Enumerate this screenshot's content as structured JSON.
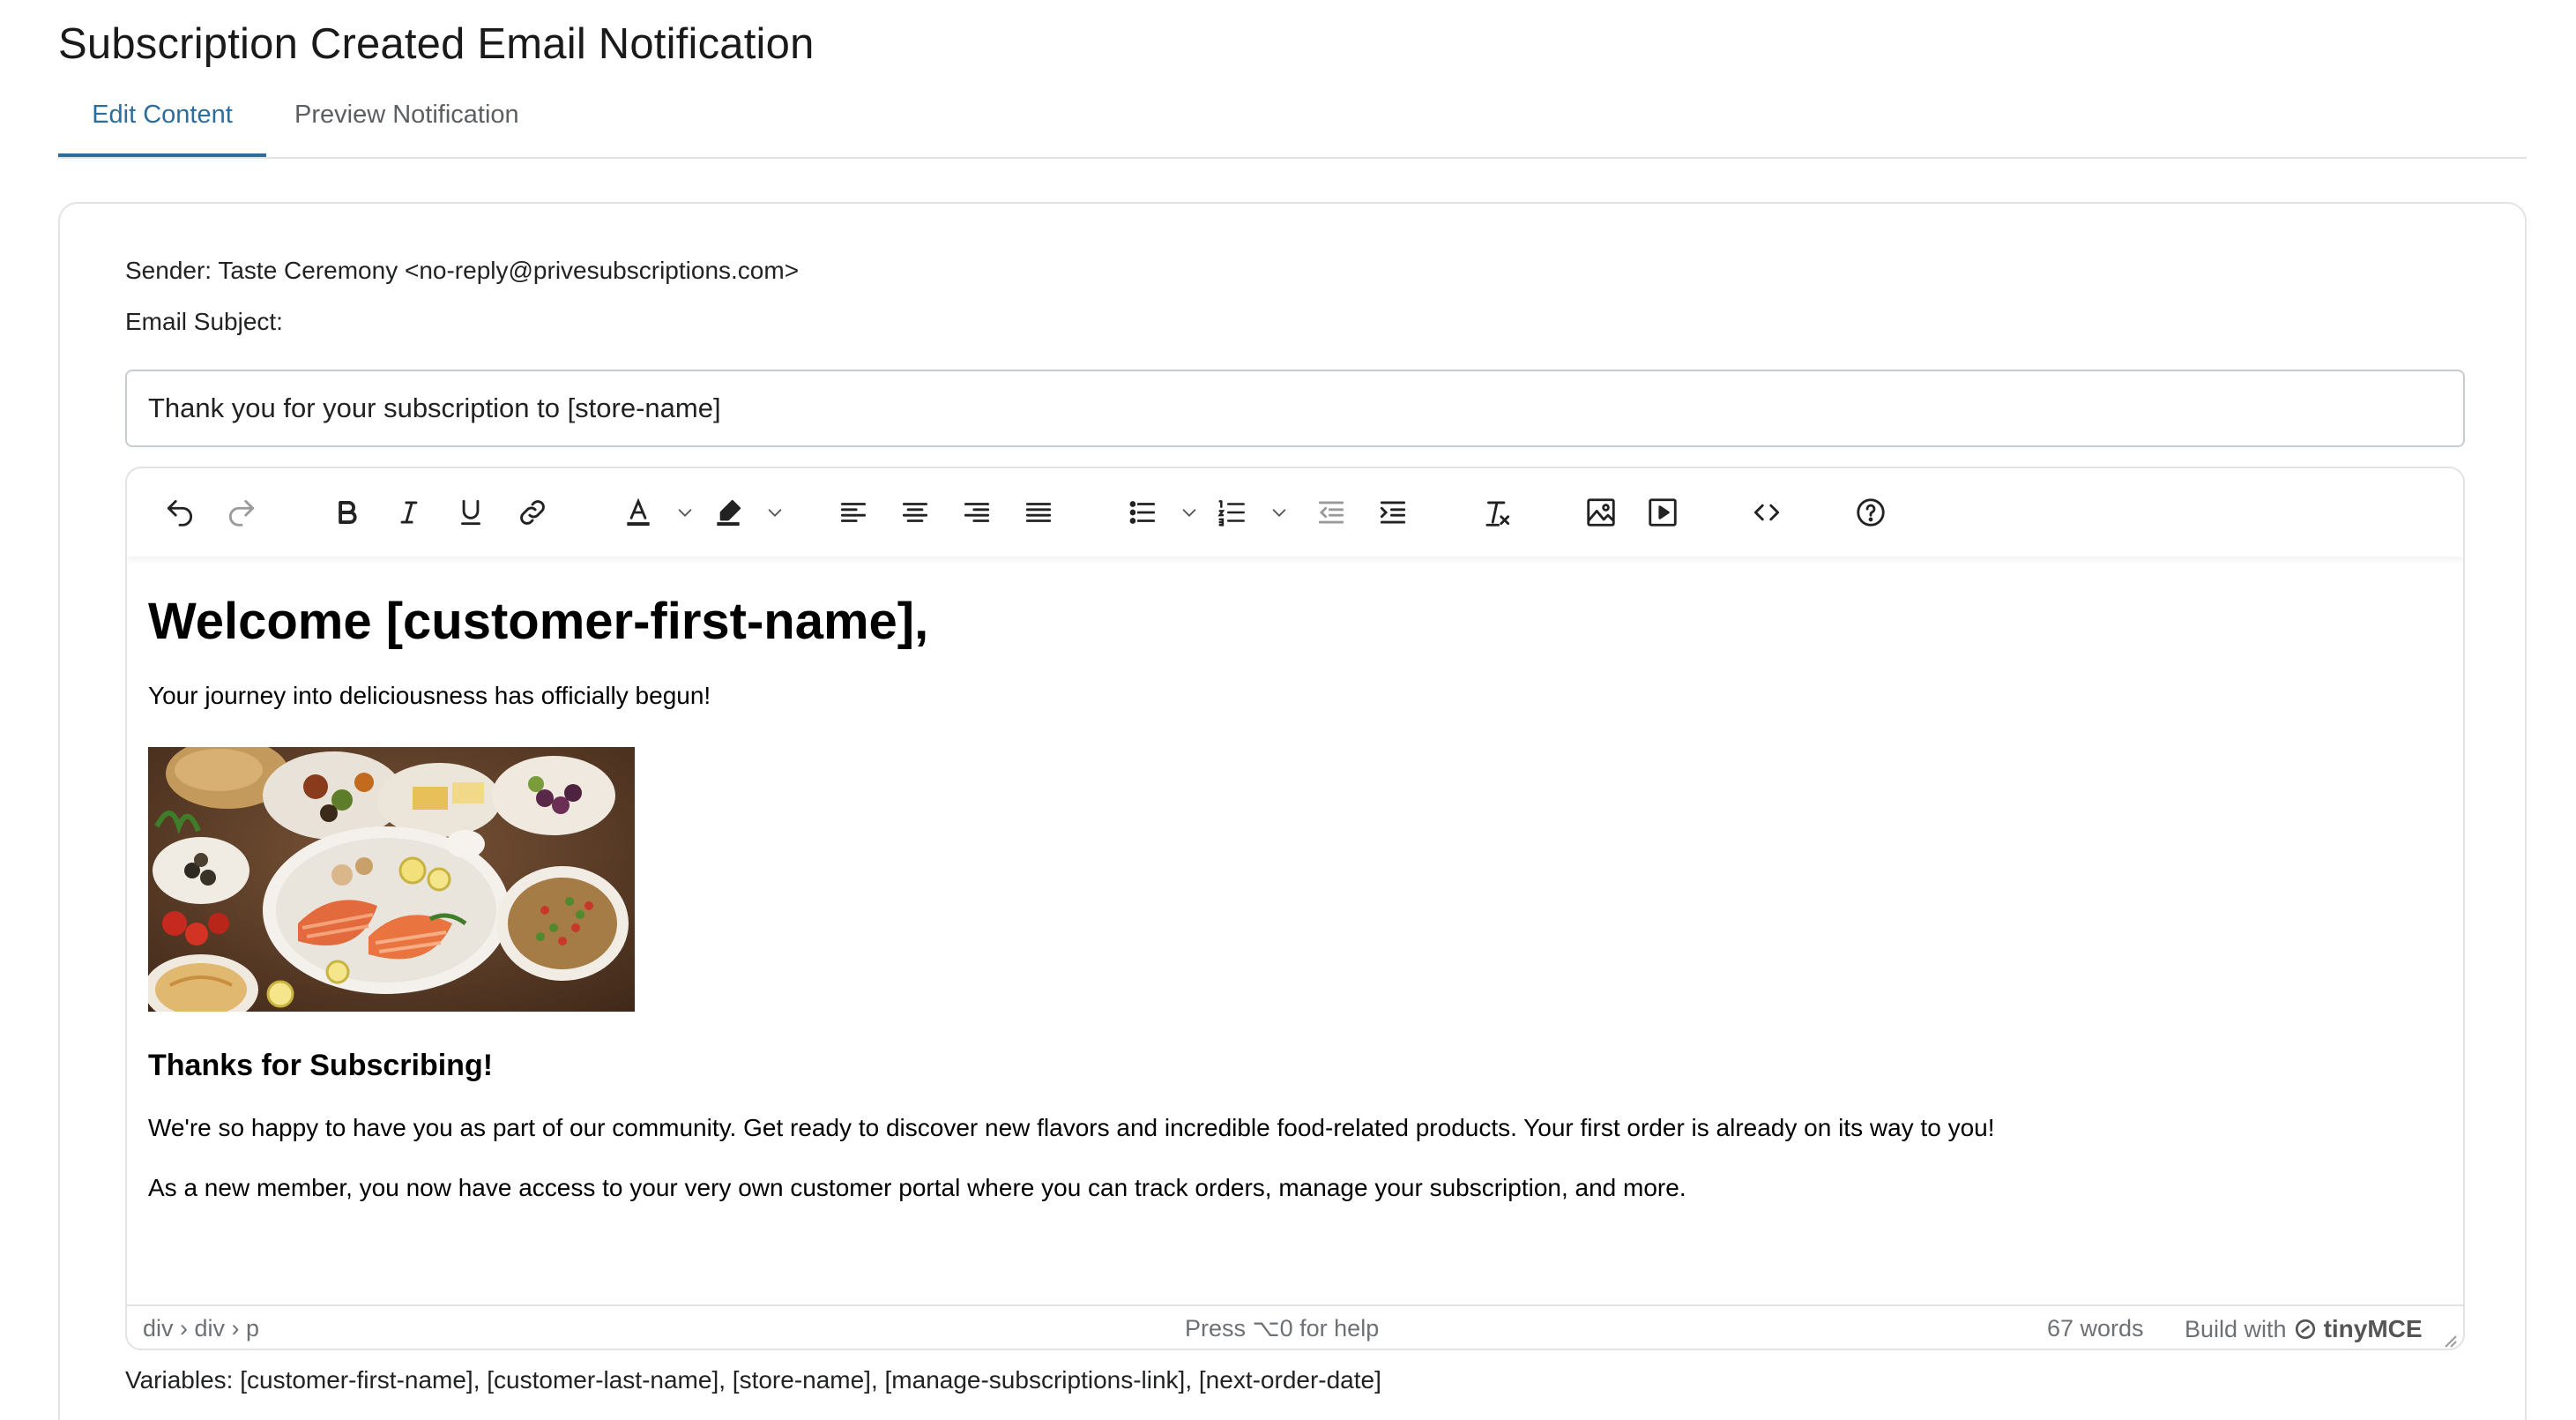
{
  "page": {
    "title": "Subscription Created Email Notification"
  },
  "tabs": [
    {
      "label": "Edit Content",
      "active": true
    },
    {
      "label": "Preview Notification",
      "active": false
    }
  ],
  "form": {
    "sender": "Sender: Taste Ceremony <no-reply@privesubscriptions.com>",
    "subject_label": "Email Subject:",
    "subject_value": "Thank you for your subscription to [store-name]"
  },
  "toolbar": {
    "buttons": [
      "undo-icon",
      "redo-icon",
      "bold-icon",
      "italic-icon",
      "underline-icon",
      "link-icon",
      "text-color-icon",
      "highlight-icon",
      "align-left-icon",
      "align-center-icon",
      "align-right-icon",
      "align-justify-icon",
      "bullet-list-icon",
      "numbered-list-icon",
      "outdent-icon",
      "indent-icon",
      "clear-format-icon",
      "image-icon",
      "media-icon",
      "code-icon",
      "help-icon"
    ]
  },
  "content": {
    "heading": "Welcome [customer-first-name],",
    "intro": "Your journey into deliciousness has officially begun!",
    "subheading": "Thanks for Subscribing!",
    "paragraph1": "We're so happy to have you as part of our community. Get ready to discover new flavors and incredible food-related products. Your first order is already on its way to you!",
    "paragraph2": "As a new member, you now have access to your very own customer portal where you can track orders, manage your subscription, and more."
  },
  "statusbar": {
    "path": "div › div › p",
    "help": "Press ⌥0 for help",
    "word_count": "67 words",
    "build_with": "Build with",
    "brand": "tinyMCE"
  },
  "variables": "Variables: [customer-first-name], [customer-last-name], [store-name], [manage-subscriptions-link], [next-order-date]",
  "colors": {
    "accent": "#2c6e9b",
    "border": "#e1e3e5",
    "text": "#202223"
  }
}
